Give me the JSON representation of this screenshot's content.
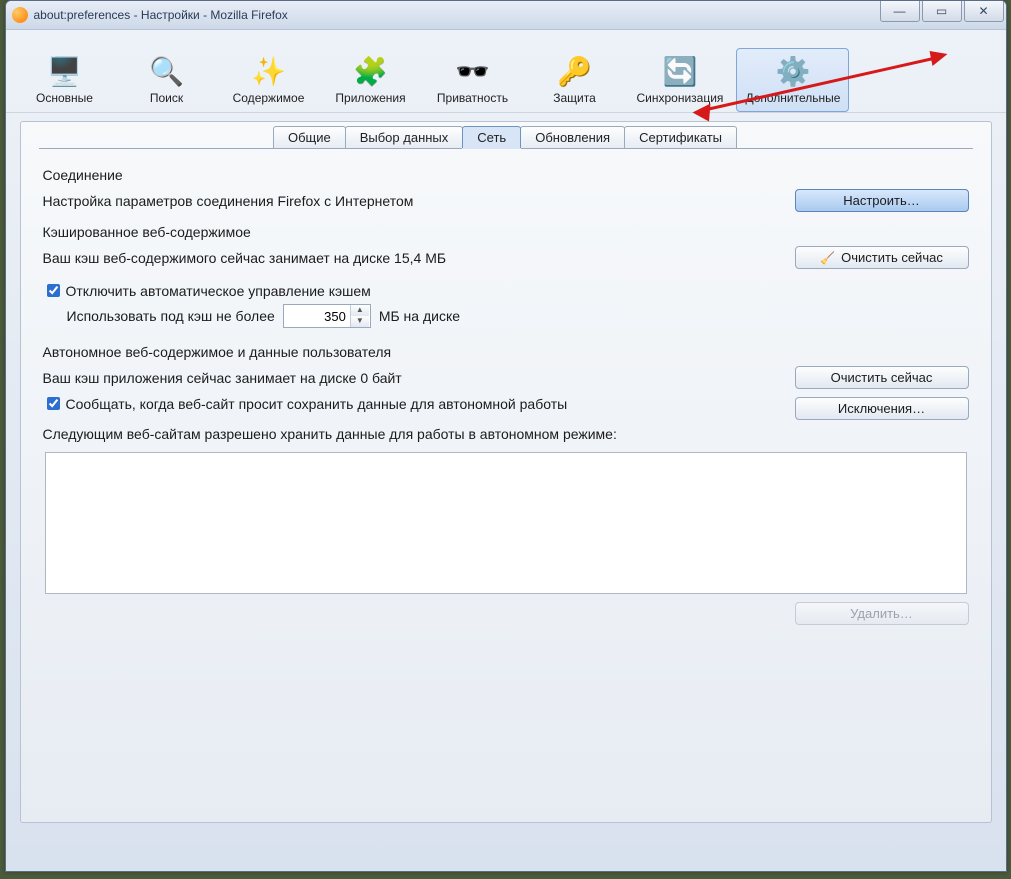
{
  "window": {
    "title": "about:preferences - Настройки - Mozilla Firefox"
  },
  "toolbar": [
    {
      "label": "Основные",
      "icon": "🖥️"
    },
    {
      "label": "Поиск",
      "icon": "🔍"
    },
    {
      "label": "Содержимое",
      "icon": "✨"
    },
    {
      "label": "Приложения",
      "icon": "🧩"
    },
    {
      "label": "Приватность",
      "icon": "🕶️"
    },
    {
      "label": "Защита",
      "icon": "🔑"
    },
    {
      "label": "Синхронизация",
      "icon": "🔄"
    },
    {
      "label": "Дополнительные",
      "icon": "⚙️",
      "active": true
    }
  ],
  "subtabs": {
    "items": [
      {
        "label": "Общие"
      },
      {
        "label": "Выбор данных"
      },
      {
        "label": "Сеть",
        "active": true
      },
      {
        "label": "Обновления"
      },
      {
        "label": "Сертификаты"
      }
    ]
  },
  "connection": {
    "title": "Соединение",
    "desc": "Настройка параметров соединения Firefox с Интернетом",
    "button": "Настроить…"
  },
  "cache": {
    "title": "Кэшированное веб-содержимое",
    "status": "Ваш кэш веб-содержимого сейчас занимает на диске 15,4 МБ",
    "clear": "Очистить сейчас",
    "override_label": "Отключить автоматическое управление кэшем",
    "override_checked": true,
    "limit_prefix": "Использовать под кэш не более",
    "limit_value": "350",
    "limit_suffix": "МБ на диске"
  },
  "offline": {
    "title": "Автономное веб-содержимое и данные пользователя",
    "status": "Ваш кэш приложения сейчас занимает на диске 0 байт",
    "clear": "Очистить сейчас",
    "notify_label": "Сообщать, когда веб-сайт просит сохранить данные для автономной работы",
    "notify_checked": true,
    "exceptions": "Исключения…",
    "list_label": "Следующим веб-сайтам разрешено хранить данные для работы в автономном режиме:",
    "remove": "Удалить…"
  }
}
